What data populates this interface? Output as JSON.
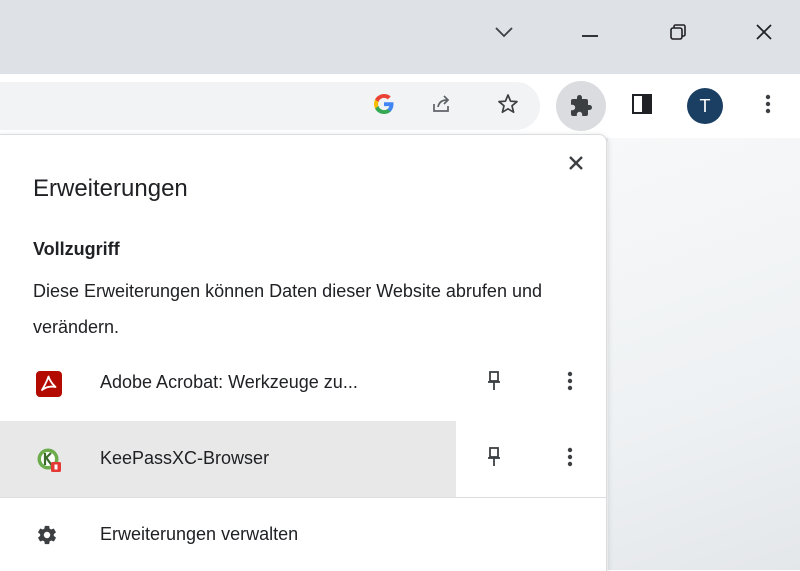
{
  "window_controls": {
    "tab_search": "chevron-down-icon",
    "minimize": "minimize-icon",
    "restore": "restore-icon",
    "close": "close-icon"
  },
  "toolbar": {
    "google_icon_letter": "G",
    "avatar_letter": "T",
    "colors": {
      "avatar": "#1a3f63",
      "accent_blue": "#4285f4",
      "accent_red": "#ea4335",
      "accent_yellow": "#fbbc05",
      "accent_green": "#34a853"
    }
  },
  "popup": {
    "title": "Erweiterungen",
    "section_heading": "Vollzugriff",
    "section_description": "Diese Erweiterungen können Daten dieser Website abrufen und verändern.",
    "extensions": [
      {
        "name": "Adobe Acrobat: Werkzeuge zu...",
        "icon": "adobe-acrobat-icon",
        "icon_color": "#b30b00",
        "hovered": false
      },
      {
        "name": "KeePassXC-Browser",
        "icon": "keepassxc-icon",
        "icon_color": "#6cac4d",
        "hovered": true
      }
    ],
    "manage_label": "Erweiterungen verwalten"
  }
}
